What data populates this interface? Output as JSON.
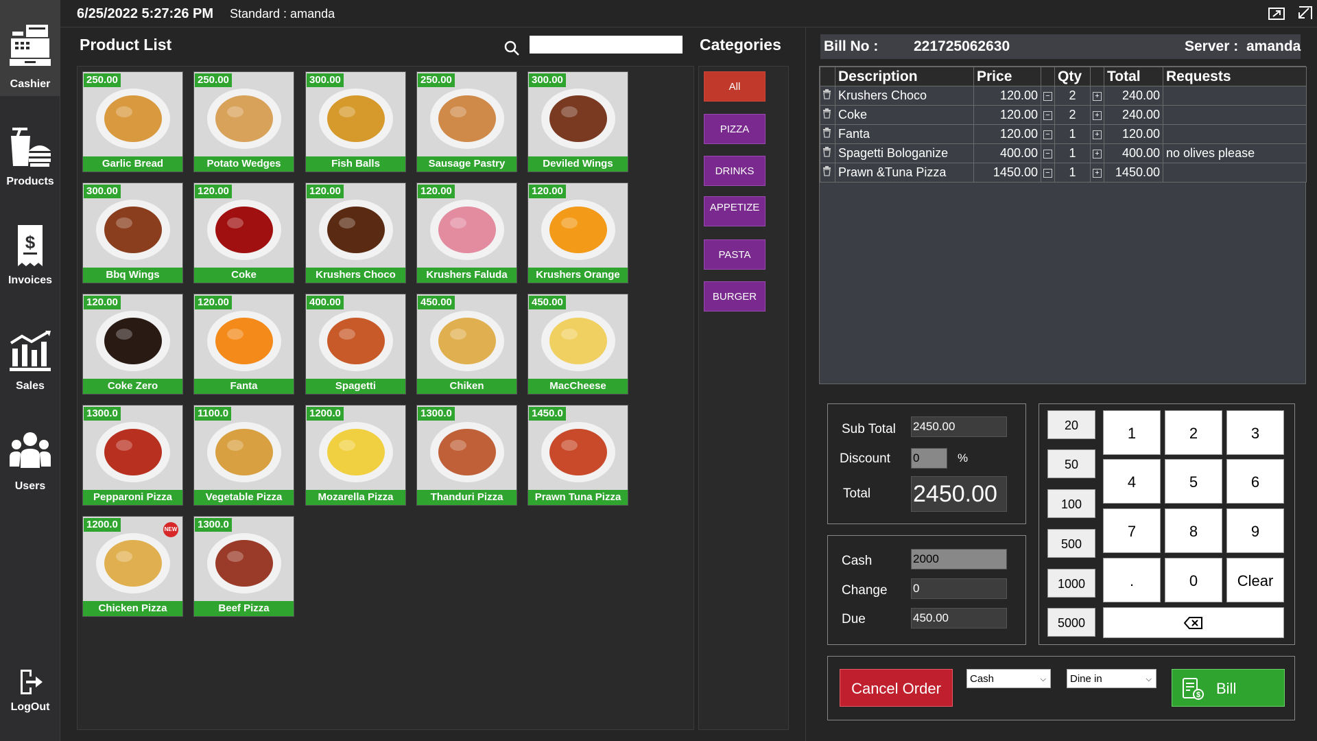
{
  "header": {
    "datetime": "6/25/2022 5:27:26 PM",
    "user_info": "Standard : amanda"
  },
  "sidebar": {
    "items": [
      {
        "label": "Cashier",
        "icon": "cash-register-icon"
      },
      {
        "label": "Products",
        "icon": "food-icon"
      },
      {
        "label": "Invoices",
        "icon": "invoice-icon"
      },
      {
        "label": "Sales",
        "icon": "chart-icon"
      },
      {
        "label": "Users",
        "icon": "users-icon"
      },
      {
        "label": "LogOut",
        "icon": "logout-icon"
      }
    ]
  },
  "products": {
    "title": "Product List",
    "search_placeholder": "",
    "items": [
      {
        "price": "250.00",
        "name": "Garlic Bread",
        "color": "#d99a3f"
      },
      {
        "price": "250.00",
        "name": "Potato Wedges",
        "color": "#d9a25a"
      },
      {
        "price": "300.00",
        "name": "Fish Balls",
        "color": "#d69a2c"
      },
      {
        "price": "250.00",
        "name": "Sausage Pastry",
        "color": "#cf8a4a"
      },
      {
        "price": "300.00",
        "name": "Deviled Wings",
        "color": "#7a3a22"
      },
      {
        "price": "300.00",
        "name": "Bbq Wings",
        "color": "#8a3e1e"
      },
      {
        "price": "120.00",
        "name": "Coke",
        "color": "#a01010"
      },
      {
        "price": "120.00",
        "name": "Krushers Choco",
        "color": "#5a2a12"
      },
      {
        "price": "120.00",
        "name": "Krushers Faluda",
        "color": "#e38ca0"
      },
      {
        "price": "120.00",
        "name": "Krushers Orange",
        "color": "#f39a18"
      },
      {
        "price": "120.00",
        "name": "Coke Zero",
        "color": "#2a1a14"
      },
      {
        "price": "120.00",
        "name": "Fanta",
        "color": "#f38a1a"
      },
      {
        "price": "400.00",
        "name": "Spagetti",
        "color": "#c85a2a"
      },
      {
        "price": "450.00",
        "name": "Chiken",
        "color": "#e0b050"
      },
      {
        "price": "450.00",
        "name": "MacCheese",
        "color": "#f0d060"
      },
      {
        "price": "1300.0",
        "name": "Pepparoni Pizza",
        "color": "#b83020"
      },
      {
        "price": "1100.0",
        "name": "Vegetable Pizza",
        "color": "#d8a040"
      },
      {
        "price": "1200.0",
        "name": "Mozarella Pizza",
        "color": "#f0d040"
      },
      {
        "price": "1300.0",
        "name": "Thanduri Pizza",
        "color": "#c06038"
      },
      {
        "price": "1450.0",
        "name": "Prawn Tuna Pizza",
        "color": "#c84a2a"
      },
      {
        "price": "1200.0",
        "name": "Chicken Pizza",
        "color": "#e0b050",
        "badge": "NEW"
      },
      {
        "price": "1300.0",
        "name": "Beef Pizza",
        "color": "#9a3a28"
      }
    ]
  },
  "categories": {
    "title": "Categories",
    "items": [
      "All",
      "PIZZA",
      "DRINKS",
      "APPETIZE",
      "PASTA",
      "BURGER"
    ],
    "active": "All"
  },
  "bill": {
    "bill_no_label": "Bill No :",
    "bill_no": "221725062630",
    "server_label": "Server :",
    "server": "amanda",
    "columns": [
      "Description",
      "Price",
      "Qty",
      "Total",
      "Requests"
    ],
    "rows": [
      {
        "description": "Krushers Choco",
        "price": "120.00",
        "qty": "2",
        "total": "240.00",
        "requests": ""
      },
      {
        "description": "Coke",
        "price": "120.00",
        "qty": "2",
        "total": "240.00",
        "requests": ""
      },
      {
        "description": "Fanta",
        "price": "120.00",
        "qty": "1",
        "total": "120.00",
        "requests": ""
      },
      {
        "description": "Spagetti Bologanize",
        "price": "400.00",
        "qty": "1",
        "total": "400.00",
        "requests": "no olives please"
      },
      {
        "description": "Prawn &Tuna Pizza",
        "price": "1450.00",
        "qty": "1",
        "total": "1450.00",
        "requests": ""
      }
    ]
  },
  "totals": {
    "subtotal_label": "Sub Total",
    "subtotal": "2450.00",
    "discount_label": "Discount",
    "discount": "0",
    "discount_unit": "%",
    "total_label": "Total",
    "total": "2450.00"
  },
  "payment": {
    "cash_label": "Cash",
    "cash": "2000",
    "change_label": "Change",
    "change": "0",
    "due_label": "Due",
    "due": "450.00"
  },
  "keypad": {
    "quick": [
      "20",
      "50",
      "100",
      "500",
      "1000",
      "5000"
    ],
    "digits": [
      "1",
      "2",
      "3",
      "4",
      "5",
      "6",
      "7",
      "8",
      "9",
      ".",
      "0",
      "Clear"
    ]
  },
  "actions": {
    "cancel": "Cancel Order",
    "payment_method": "Cash",
    "order_type": "Dine in",
    "bill": "Bill"
  }
}
